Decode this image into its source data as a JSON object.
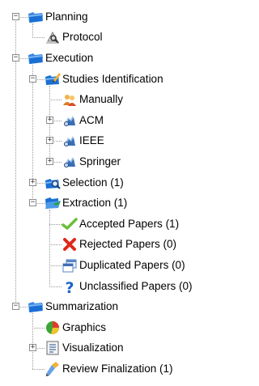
{
  "tree": {
    "nodes": [
      {
        "label": "Planning",
        "depth": 0,
        "expanded": true,
        "icon": "blue-folder-icon",
        "has_children": true
      },
      {
        "label": "Protocol",
        "depth": 1,
        "expanded": null,
        "icon": "protocol-icon",
        "has_children": false
      },
      {
        "label": "Execution",
        "depth": 0,
        "expanded": true,
        "icon": "blue-folder-icon",
        "has_children": true
      },
      {
        "label": "Studies Identification",
        "depth": 1,
        "expanded": true,
        "icon": "blue-folder-pencil-icon",
        "has_children": true
      },
      {
        "label": "Manually",
        "depth": 2,
        "expanded": null,
        "icon": "people-icon",
        "has_children": false
      },
      {
        "label": "ACM",
        "depth": 2,
        "expanded": false,
        "icon": "search-source-icon",
        "has_children": true
      },
      {
        "label": "IEEE",
        "depth": 2,
        "expanded": false,
        "icon": "search-source-icon",
        "has_children": true
      },
      {
        "label": "Springer",
        "depth": 2,
        "expanded": false,
        "icon": "search-source-icon",
        "has_children": true
      },
      {
        "label": "Selection (1)",
        "depth": 1,
        "expanded": false,
        "icon": "blue-folder-search-icon",
        "has_children": true
      },
      {
        "label": "Extraction (1)",
        "depth": 1,
        "expanded": true,
        "icon": "blue-folder-open-icon",
        "has_children": true
      },
      {
        "label": "Accepted Papers (1)",
        "depth": 2,
        "expanded": null,
        "icon": "green-check-icon",
        "has_children": false
      },
      {
        "label": "Rejected Papers (0)",
        "depth": 2,
        "expanded": null,
        "icon": "red-x-icon",
        "has_children": false
      },
      {
        "label": "Duplicated Papers (0)",
        "depth": 2,
        "expanded": null,
        "icon": "duplicate-windows-icon",
        "has_children": false
      },
      {
        "label": "Unclassified Papers (0)",
        "depth": 2,
        "expanded": null,
        "icon": "blue-question-icon",
        "has_children": false
      },
      {
        "label": "Summarization",
        "depth": 0,
        "expanded": true,
        "icon": "blue-folder-icon",
        "has_children": true
      },
      {
        "label": "Graphics",
        "depth": 1,
        "expanded": null,
        "icon": "pie-chart-icon",
        "has_children": false
      },
      {
        "label": "Visualization",
        "depth": 1,
        "expanded": false,
        "icon": "document-list-icon",
        "has_children": true
      },
      {
        "label": "Review Finalization (1)",
        "depth": 1,
        "expanded": null,
        "icon": "finalize-icon",
        "has_children": false
      }
    ]
  },
  "colors": {
    "tree_line": "#9a9a9a",
    "folder_blue": "#1a6fd4",
    "check_green": "#6abf3a",
    "reject_red": "#e0281a"
  }
}
